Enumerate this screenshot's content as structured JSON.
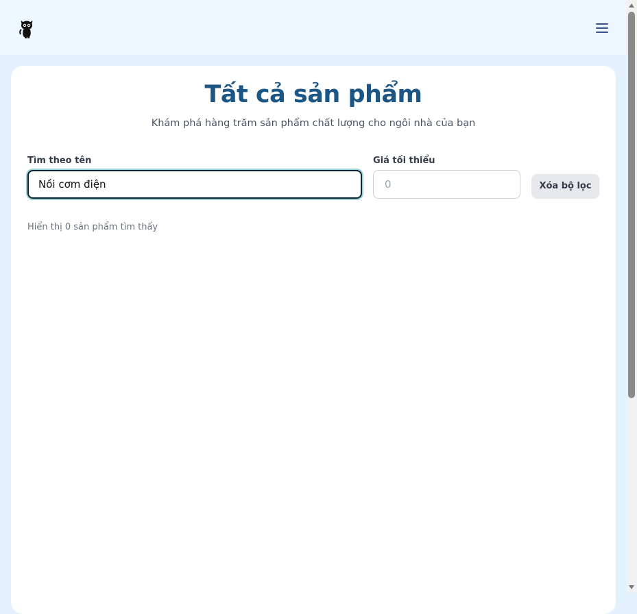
{
  "header": {
    "logo_icon": "black-cat-logo",
    "menu_icon": "hamburger-menu-icon"
  },
  "main": {
    "title": "Tất cả sản phẩm",
    "subtitle": "Khám phá hàng trăm sản phẩm chất lượng cho ngôi nhà của bạn"
  },
  "filters": {
    "name_label": "Tìm theo tên",
    "name_value": "Nồi cơm điện",
    "min_price_label": "Giá tối thiểu",
    "min_price_placeholder": "0",
    "clear_label": "Xóa bộ lọc"
  },
  "results": {
    "summary": "Hiển thị 0 sản phẩm tìm thấy"
  },
  "colors": {
    "title": "#1c5685",
    "page_bg": "#e3f1ff",
    "header_bg": "#eef6ff"
  }
}
